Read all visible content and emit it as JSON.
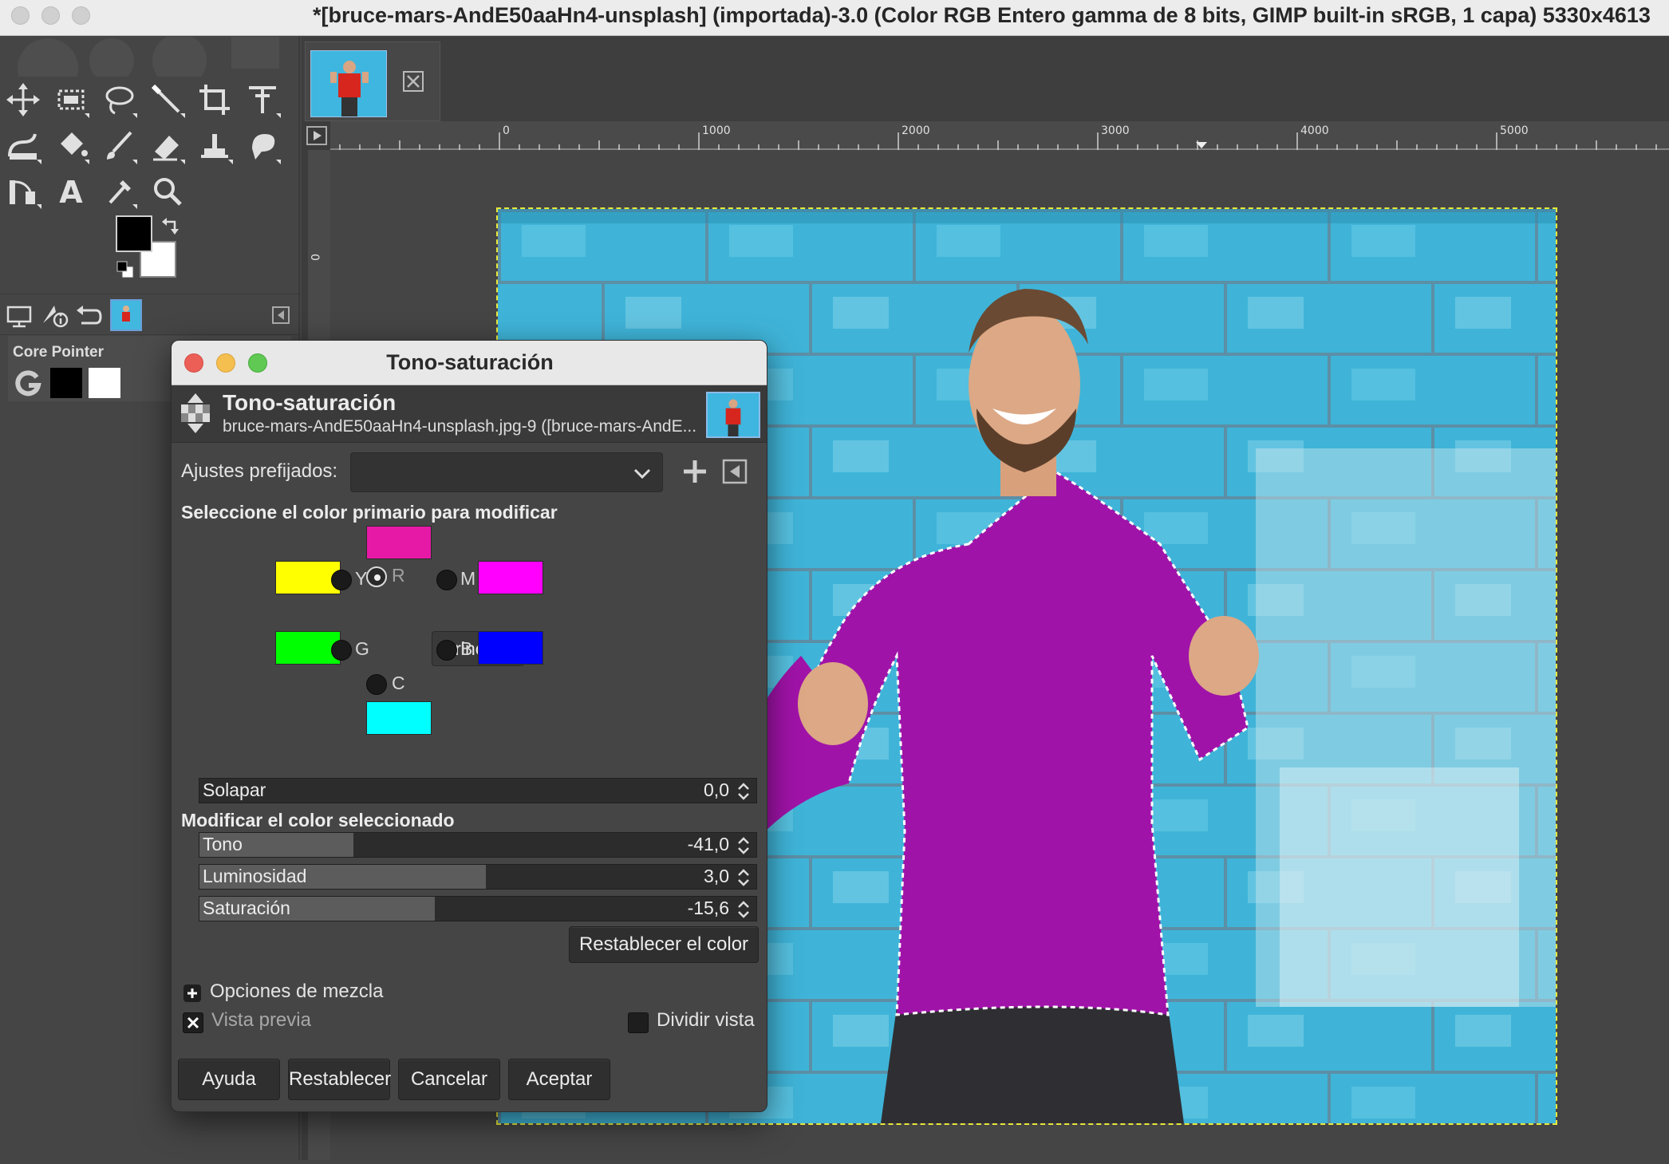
{
  "window": {
    "title": "*[bruce-mars-AndE50aaHn4-unsplash] (importada)-3.0 (Color RGB Entero gamma de 8 bits, GIMP built-in sRGB, 1 capa) 5330x4613"
  },
  "toolbox": {
    "tools": [
      "move-tool",
      "rect-select-tool",
      "lasso-tool",
      "fuzzy-select-tool",
      "crop-tool",
      "transform-tool",
      "warp-tool",
      "bucket-fill-tool",
      "paintbrush-tool",
      "eraser-tool",
      "clone-tool",
      "smudge-tool",
      "paths-tool",
      "text-tool",
      "color-picker-tool",
      "zoom-tool"
    ],
    "foreground_color": "#000000",
    "background_color": "#ffffff",
    "device_status": {
      "label": "Core Pointer"
    }
  },
  "canvas": {
    "ruler_labels": [
      "0",
      "1000",
      "2000",
      "3000",
      "4000",
      "5000"
    ],
    "vruler_label": "0"
  },
  "dialog": {
    "window_title": "Tono-saturación",
    "header_title": "Tono-saturación",
    "header_subtitle": "bruce-mars-AndE50aaHn4-unsplash.jpg-9 ([bruce-mars-AndE...",
    "presets_label": "Ajustes prefijados:",
    "presets_value": "",
    "select_primary_label": "Seleccione el color primario para modificar",
    "primaries": {
      "R": {
        "label": "R",
        "color": "#e619a6",
        "selected": true
      },
      "Y": {
        "label": "Y",
        "color": "#ffff00",
        "selected": false
      },
      "M": {
        "label": "M",
        "color": "#ff00ff",
        "selected": false
      },
      "G": {
        "label": "G",
        "color": "#00ff00",
        "selected": false
      },
      "B": {
        "label": "B",
        "color": "#0000ff",
        "selected": false
      },
      "C": {
        "label": "C",
        "color": "#00ffff",
        "selected": false
      }
    },
    "master_label": "Principal",
    "overlap": {
      "label": "Solapar",
      "value": "0,0"
    },
    "modify_label": "Modificar el color seleccionado",
    "hue": {
      "label": "Tono",
      "value": "-41,0"
    },
    "lightness": {
      "label": "Luminosidad",
      "value": "3,0"
    },
    "saturation": {
      "label": "Saturación",
      "value": "-15,6"
    },
    "reset_color_label": "Restablecer el color",
    "blending_label": "Opciones de mezcla",
    "preview_label": "Vista previa",
    "preview_checked": true,
    "split_view_label": "Dividir vista",
    "split_view_checked": false,
    "buttons": {
      "help": "Ayuda",
      "reset": "Restablecer",
      "cancel": "Cancelar",
      "ok": "Aceptar"
    }
  }
}
